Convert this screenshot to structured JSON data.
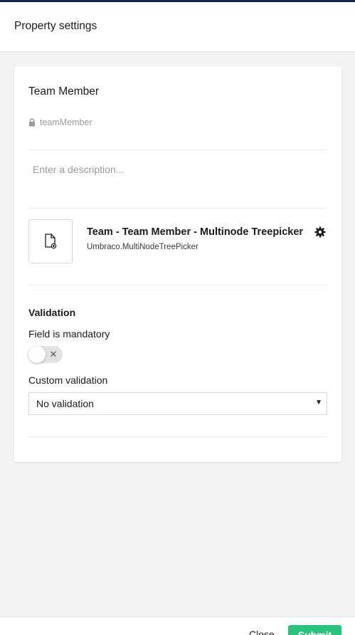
{
  "header": {
    "title": "Property settings"
  },
  "property": {
    "name": "Team Member",
    "alias": "teamMember",
    "description_placeholder": "Enter a description..."
  },
  "editor": {
    "name": "Team - Team Member - Multinode Treepicker",
    "alias": "Umbraco.MultiNodeTreePicker",
    "icon": "document-add-icon"
  },
  "validation": {
    "heading": "Validation",
    "mandatory_label": "Field is mandatory",
    "mandatory_on": false,
    "custom_label": "Custom validation",
    "custom_value": "No validation"
  },
  "footer": {
    "close_label": "Close",
    "submit_label": "Submit"
  },
  "colors": {
    "accent": "#2bc37c",
    "brand": "#1b264f"
  }
}
